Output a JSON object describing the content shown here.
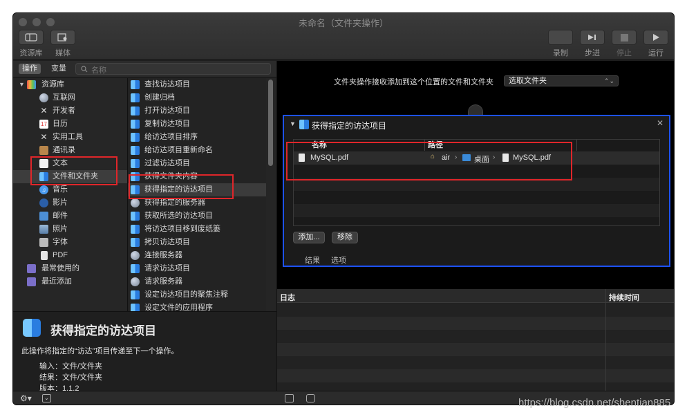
{
  "window": {
    "title": "未命名（文件夹操作）"
  },
  "toolbar": {
    "library_label": "资源库",
    "media_label": "媒体",
    "record_label": "录制",
    "step_label": "步进",
    "stop_label": "停止",
    "run_label": "运行"
  },
  "left": {
    "tab_actions": "操作",
    "tab_variables": "变量",
    "search_placeholder": "名称"
  },
  "library": [
    {
      "label": "资源库",
      "icon": "library-icon",
      "level": 0,
      "expanded": true
    },
    {
      "label": "互联网",
      "icon": "globe-icon",
      "level": 1
    },
    {
      "label": "开发者",
      "icon": "tools-icon",
      "level": 1
    },
    {
      "label": "日历",
      "icon": "calendar-icon",
      "level": 1
    },
    {
      "label": "实用工具",
      "icon": "utilities-icon",
      "level": 1
    },
    {
      "label": "通讯录",
      "icon": "contacts-icon",
      "level": 1
    },
    {
      "label": "文本",
      "icon": "text-icon",
      "level": 1
    },
    {
      "label": "文件和文件夹",
      "icon": "finder-icon",
      "level": 1,
      "selected": true
    },
    {
      "label": "音乐",
      "icon": "music-icon",
      "level": 1
    },
    {
      "label": "影片",
      "icon": "movie-icon",
      "level": 1
    },
    {
      "label": "邮件",
      "icon": "mail-icon",
      "level": 1
    },
    {
      "label": "照片",
      "icon": "photos-icon",
      "level": 1
    },
    {
      "label": "字体",
      "icon": "font-icon",
      "level": 1
    },
    {
      "label": "PDF",
      "icon": "pdf-icon",
      "level": 1
    },
    {
      "label": "最常使用的",
      "icon": "smart-folder-icon",
      "level": 0
    },
    {
      "label": "最近添加",
      "icon": "smart-folder-icon",
      "level": 0
    }
  ],
  "actions": [
    {
      "label": "查找访达项目",
      "icon": "finder-icon"
    },
    {
      "label": "创建归档",
      "icon": "finder-icon"
    },
    {
      "label": "打开访达项目",
      "icon": "finder-icon"
    },
    {
      "label": "复制访达项目",
      "icon": "finder-icon"
    },
    {
      "label": "给访达项目排序",
      "icon": "finder-icon"
    },
    {
      "label": "给访达项目重新命名",
      "icon": "finder-icon"
    },
    {
      "label": "过滤访达项目",
      "icon": "finder-icon"
    },
    {
      "label": "获得文件夹内容",
      "icon": "finder-icon"
    },
    {
      "label": "获得指定的访达项目",
      "icon": "finder-icon",
      "selected": true
    },
    {
      "label": "获得指定的服务器",
      "icon": "globe-icon"
    },
    {
      "label": "获取所选的访达项目",
      "icon": "finder-icon"
    },
    {
      "label": "将访达项目移到废纸篓",
      "icon": "finder-icon"
    },
    {
      "label": "拷贝访达项目",
      "icon": "finder-icon"
    },
    {
      "label": "连接服务器",
      "icon": "globe-icon"
    },
    {
      "label": "请求访达项目",
      "icon": "finder-icon"
    },
    {
      "label": "请求服务器",
      "icon": "globe-icon"
    },
    {
      "label": "设定访达项目的聚焦注释",
      "icon": "finder-icon"
    },
    {
      "label": "设定文件的应用程序",
      "icon": "finder-icon"
    }
  ],
  "description": {
    "title": "获得指定的访达项目",
    "text": "此操作将指定的“访达”项目传递至下一个操作。",
    "input": "输入：文件/文件夹",
    "result": "结果：文件/文件夹",
    "version": "版本：1.1.2"
  },
  "workflow": {
    "receive_text": "文件夹操作接收添加到这个位置的文件和文件夹",
    "select_value": "选取文件夹"
  },
  "action_card": {
    "title": "获得指定的访达项目",
    "col_name": "名称",
    "col_path": "路径",
    "file_name": "MySQL.pdf",
    "path": [
      "air",
      "桌面",
      "MySQL.pdf"
    ],
    "add_button": "添加...",
    "remove_button": "移除",
    "tab_results": "结果",
    "tab_options": "选项"
  },
  "log": {
    "col_log": "日志",
    "col_duration": "持续时间"
  },
  "watermark": "https://blog.csdn.net/shentian885"
}
